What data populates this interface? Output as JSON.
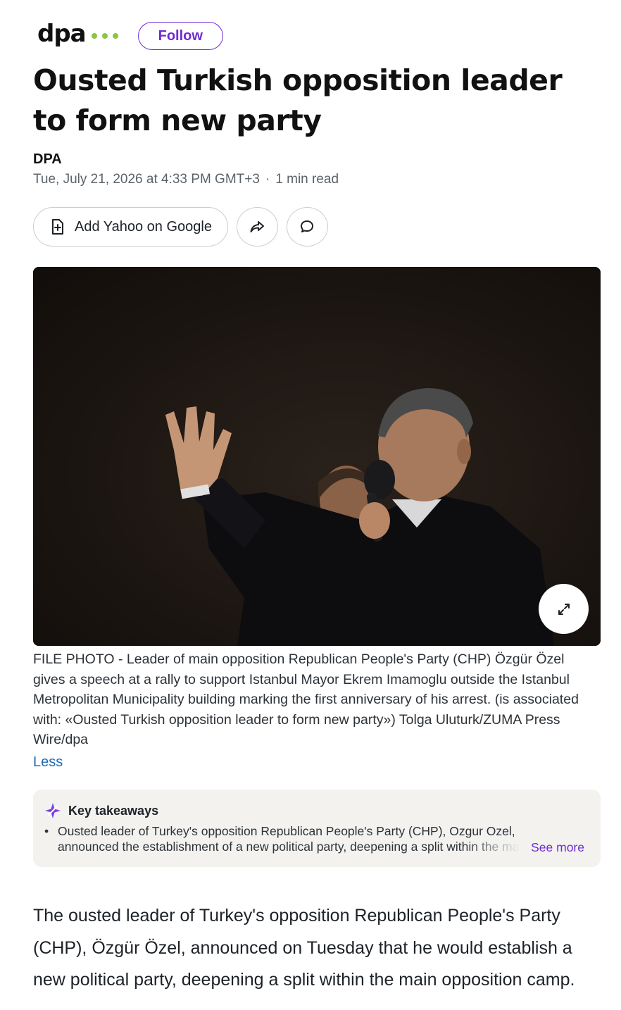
{
  "publisher": {
    "logo_text": "dpa",
    "follow_label": "Follow"
  },
  "article": {
    "title": "Ousted Turkish opposition leader to form new party",
    "byline": "DPA",
    "date": "Tue, July 21, 2026 at 4:33 PM GMT+3",
    "read_time": "1 min read"
  },
  "actions": {
    "add_google_label": "Add Yahoo on Google"
  },
  "photo": {
    "caption": "FILE PHOTO - Leader of main opposition Republican People's Party (CHP) Özgür Özel gives a speech at a rally to support Istanbul Mayor Ekrem Imamoglu outside the Istanbul Metropolitan Municipality building marking the first anniversary of his arrest. (is associated with: «Ousted Turkish opposition leader to form new party») Tolga Uluturk/ZUMA Press Wire/dpa",
    "less_label": "Less"
  },
  "takeaways": {
    "heading": "Key takeaways",
    "line1": "Ousted leader of Turkey's opposition Republican People's Party (CHP), Ozgur Ozel,",
    "line2": "announced the establishment of a new political party, deepening a split within the main",
    "see_more": "See more"
  },
  "body": {
    "paragraph1": "The ousted leader of Turkey's opposition Republican People's Party (CHP), Özgür Özel, announced on Tuesday that he would establish a new political party, deepening a split within the main opposition camp."
  },
  "colors": {
    "accent_purple": "#6e2bd4",
    "logo_green": "#8cc63f",
    "link_blue": "#1f6ab5"
  }
}
